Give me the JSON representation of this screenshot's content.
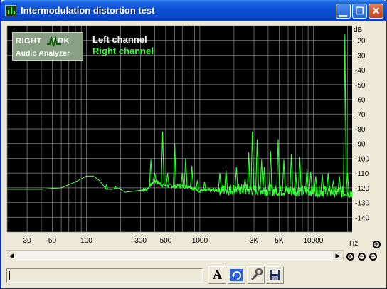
{
  "window": {
    "title": "Intermodulation distortion test"
  },
  "logo": {
    "line1a": "RIGHT",
    "line1b": "ARK",
    "line2": "Audio Analyzer"
  },
  "legend": {
    "left": "Left channel",
    "right": "Right channel"
  },
  "colors": {
    "plot_bg": "#000000",
    "grid": "#8a8a8a",
    "left": "#ffffff",
    "right": "#33ff33",
    "title_bar": "#0a4fd4"
  },
  "chart_data": {
    "type": "line",
    "x_scale": "log",
    "xlim": [
      20,
      22000
    ],
    "ylim": [
      -150,
      -10
    ],
    "yunit": "dB",
    "xunit": "Hz",
    "x_tick_labels": [
      {
        "v": 30,
        "t": "30"
      },
      {
        "v": 50,
        "t": "50"
      },
      {
        "v": 100,
        "t": "100"
      },
      {
        "v": 300,
        "t": "300"
      },
      {
        "v": 500,
        "t": "500"
      },
      {
        "v": 1000,
        "t": "1000"
      },
      {
        "v": 3000,
        "t": "3K"
      },
      {
        "v": 5000,
        "t": "5K"
      },
      {
        "v": 10000,
        "t": "10000"
      }
    ],
    "y_ticks": [
      -20,
      -30,
      -40,
      -50,
      -60,
      -70,
      -80,
      -90,
      -100,
      -110,
      -120,
      -130,
      -140
    ],
    "series": [
      {
        "name": "Left channel",
        "color": "#ffffff",
        "points": [
          [
            20,
            -121
          ],
          [
            40,
            -121
          ],
          [
            60,
            -120
          ],
          [
            80,
            -116
          ],
          [
            100,
            -112
          ],
          [
            115,
            -112
          ],
          [
            130,
            -115
          ],
          [
            150,
            -121
          ],
          [
            170,
            -121
          ],
          [
            190,
            -120
          ],
          [
            220,
            -123
          ],
          [
            280,
            -122
          ],
          [
            340,
            -121
          ],
          [
            400,
            -115
          ],
          [
            460,
            -118
          ],
          [
            600,
            -119
          ],
          [
            800,
            -119
          ],
          [
            1000,
            -122
          ],
          [
            2000,
            -121
          ],
          [
            5000,
            -122
          ],
          [
            10000,
            -122
          ],
          [
            20000,
            -123
          ]
        ]
      },
      {
        "name": "Right channel",
        "color": "#33ff33",
        "points": [
          [
            20,
            -121
          ],
          [
            40,
            -121
          ],
          [
            60,
            -120
          ],
          [
            80,
            -116
          ],
          [
            100,
            -112
          ],
          [
            115,
            -112
          ],
          [
            130,
            -115
          ],
          [
            150,
            -121
          ],
          [
            170,
            -121
          ],
          [
            190,
            -120
          ],
          [
            220,
            -123
          ],
          [
            280,
            -122
          ],
          [
            340,
            -121
          ],
          [
            400,
            -115
          ],
          [
            460,
            -118
          ],
          [
            600,
            -119
          ],
          [
            800,
            -119
          ],
          [
            1000,
            -122
          ],
          [
            2000,
            -121
          ],
          [
            5000,
            -122
          ],
          [
            10000,
            -122
          ],
          [
            20000,
            -123
          ]
        ],
        "peaks": [
          [
            150,
            -118
          ],
          [
            180,
            -119
          ],
          [
            370,
            -101
          ],
          [
            400,
            -110
          ],
          [
            470,
            -82
          ],
          [
            520,
            -110
          ],
          [
            600,
            -90
          ],
          [
            700,
            -110
          ],
          [
            750,
            -100
          ],
          [
            850,
            -105
          ],
          [
            950,
            -115
          ],
          [
            1100,
            -116
          ],
          [
            1500,
            -110
          ],
          [
            1700,
            -108
          ],
          [
            2100,
            -106
          ],
          [
            2500,
            -114
          ],
          [
            2700,
            -96
          ],
          [
            2900,
            -82
          ],
          [
            3200,
            -87
          ],
          [
            3500,
            -101
          ],
          [
            3700,
            -106
          ],
          [
            4200,
            -95
          ],
          [
            4900,
            -87
          ],
          [
            5500,
            -101
          ],
          [
            6400,
            -97
          ],
          [
            7000,
            -110
          ],
          [
            7600,
            -99
          ],
          [
            8800,
            -107
          ],
          [
            9500,
            -109
          ],
          [
            10500,
            -112
          ],
          [
            12000,
            -111
          ],
          [
            13500,
            -110
          ],
          [
            15000,
            -115
          ],
          [
            17000,
            -112
          ],
          [
            19000,
            -16
          ],
          [
            20000,
            -110
          ]
        ]
      }
    ]
  }
}
